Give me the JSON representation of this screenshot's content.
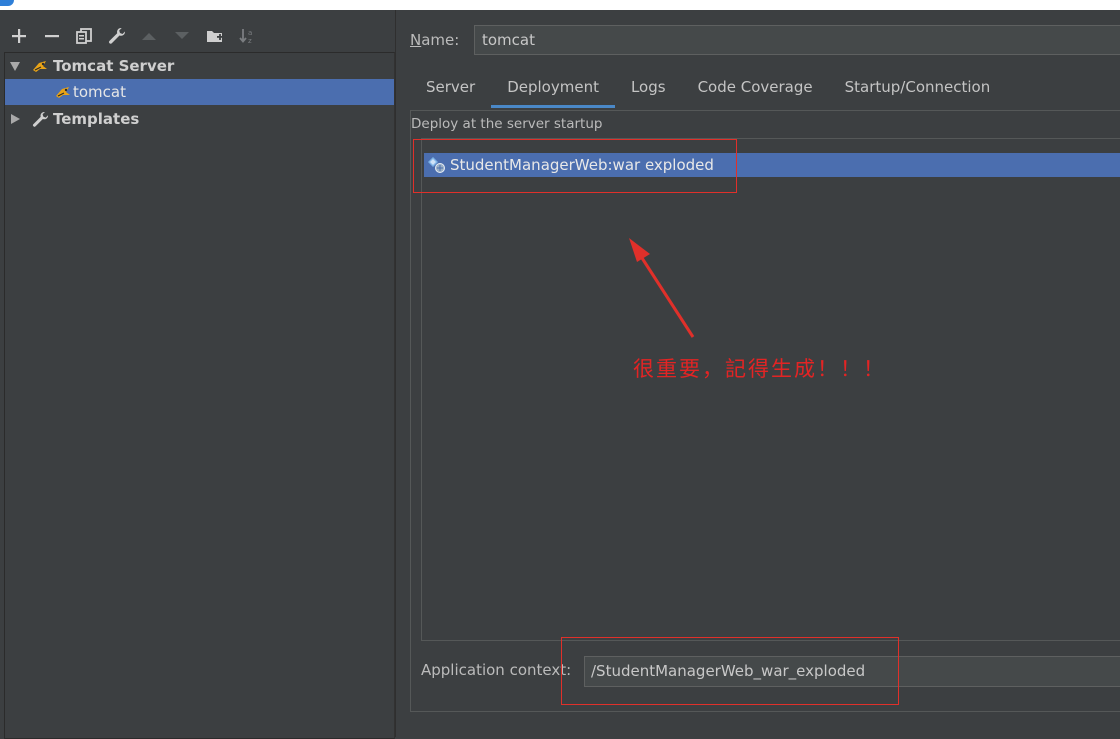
{
  "window": {
    "title_visible": false
  },
  "toolbar": {
    "icons": [
      "add-icon",
      "remove-icon",
      "copy-icon",
      "wrench-icon",
      "move-up-icon",
      "move-down-icon",
      "new-folder-icon",
      "sort-icon"
    ]
  },
  "tree": {
    "items": [
      {
        "label": "Tomcat Server",
        "expanded": true,
        "bold": true,
        "icon": "tomcat-icon"
      },
      {
        "label": "tomcat",
        "selected": true,
        "icon": "tomcat-config-icon"
      },
      {
        "label": "Templates",
        "expanded": false,
        "bold": true,
        "icon": "wrench-icon"
      }
    ]
  },
  "config": {
    "name_label_mnemonic": "N",
    "name_label_rest": "ame:",
    "name_value": "tomcat"
  },
  "tabs": [
    "Server",
    "Deployment",
    "Logs",
    "Code Coverage",
    "Startup/Connection"
  ],
  "active_tab": "Deployment",
  "deployment": {
    "section_label": "Deploy at the server startup",
    "artifacts": [
      "StudentManagerWeb:war exploded"
    ],
    "context_label": "Application context:",
    "context_value": "/StudentManagerWeb_war_exploded"
  },
  "annotation": {
    "text": "很重要，記得生成！！！",
    "color": "#e32424"
  },
  "colors": {
    "background": "#3c3f41",
    "selection": "#4b6eaf",
    "tab_underline": "#4a88c7",
    "annotation_red": "#e0302a"
  }
}
